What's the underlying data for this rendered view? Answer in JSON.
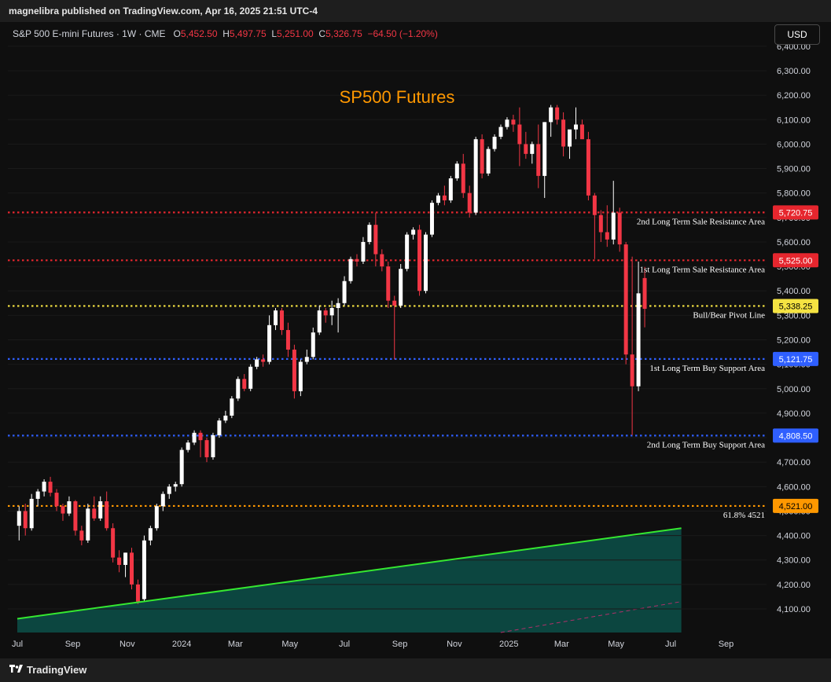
{
  "publisher": {
    "text": "magnelibra published on TradingView.com, Apr 16, 2025 21:51 UTC-4"
  },
  "legend": {
    "symbol": "S&P 500 E-mini Futures · 1W · CME",
    "open_label": "O",
    "open": "5,452.50",
    "high_label": "H",
    "high": "5,497.75",
    "low_label": "L",
    "low": "5,251.00",
    "close_label": "C",
    "close": "5,326.75",
    "change": "−64.50 (−1.20%)"
  },
  "currency": "USD",
  "footer": {
    "brand": "TradingView"
  },
  "colors": {
    "background": "#0f0f0f",
    "up": "#ffffff",
    "down": "#f23645",
    "title": "#ff9800",
    "trendline": "#35e830",
    "fill": "#0d4a43",
    "resistance": "#e6262e",
    "pivot": "#f5e342",
    "support": "#2f5fff",
    "fib": "#ff9800"
  },
  "chart_data": {
    "type": "candlestick",
    "title": "SP500 Futures",
    "x_ticks": [
      "Jul",
      "Sep",
      "Nov",
      "2024",
      "Mar",
      "May",
      "Jul",
      "Sep",
      "Nov",
      "2025",
      "Mar",
      "May",
      "Jul",
      "Sep"
    ],
    "y_ticks": [
      "4,100.00",
      "4,200.00",
      "4,300.00",
      "4,400.00",
      "4,500.00",
      "4,600.00",
      "4,700.00",
      "4,800.00",
      "4,900.00",
      "5,000.00",
      "5,100.00",
      "5,200.00",
      "5,300.00",
      "5,400.00",
      "5,500.00",
      "5,600.00",
      "5,700.00",
      "5,800.00",
      "5,900.00",
      "6,000.00",
      "6,100.00",
      "6,200.00",
      "6,300.00",
      "6,400.00"
    ],
    "ylim": [
      4060,
      6420
    ],
    "x_range": [
      "2023-07-01",
      "2025-10-01"
    ],
    "levels": [
      {
        "value": 5720.75,
        "label": "5,720.75",
        "name": "2nd Long Term Sale Resistance Area",
        "color": "#e6262e",
        "text_color": "#ffffff"
      },
      {
        "value": 5525.0,
        "label": "5,525.00",
        "name": "1st Long Term Sale Resistance Area",
        "color": "#e6262e",
        "text_color": "#ffffff"
      },
      {
        "value": 5338.25,
        "label": "5,338.25",
        "name": "Bull/Bear Pivot Line",
        "color": "#f5e342",
        "text_color": "#000000"
      },
      {
        "value": 5121.75,
        "label": "5,121.75",
        "name": "1st Long Term Buy Support Area",
        "color": "#2f5fff",
        "text_color": "#ffffff"
      },
      {
        "value": 4808.5,
        "label": "4,808.50",
        "name": "2nd Long Term Buy Support Area",
        "color": "#2f5fff",
        "text_color": "#ffffff"
      },
      {
        "value": 4521.0,
        "label": "4,521.00",
        "name": "61.8% 4521",
        "color": "#ff9800",
        "text_color": "#000000"
      }
    ],
    "trendline": {
      "start": {
        "date": "2023-07-01",
        "value": 4060
      },
      "end": {
        "date": "2025-07-13",
        "value": 4430
      }
    },
    "candles": [
      {
        "date": "2023-07-03",
        "open": 4440,
        "high": 4520,
        "low": 4380,
        "close": 4500
      },
      {
        "date": "2023-07-10",
        "open": 4500,
        "high": 4530,
        "low": 4400,
        "close": 4430
      },
      {
        "date": "2023-07-17",
        "open": 4430,
        "high": 4570,
        "low": 4420,
        "close": 4550
      },
      {
        "date": "2023-07-24",
        "open": 4550,
        "high": 4590,
        "low": 4520,
        "close": 4580
      },
      {
        "date": "2023-07-31",
        "open": 4580,
        "high": 4630,
        "low": 4560,
        "close": 4620
      },
      {
        "date": "2023-08-07",
        "open": 4620,
        "high": 4640,
        "low": 4560,
        "close": 4575
      },
      {
        "date": "2023-08-14",
        "open": 4575,
        "high": 4590,
        "low": 4500,
        "close": 4520
      },
      {
        "date": "2023-08-21",
        "open": 4520,
        "high": 4530,
        "low": 4460,
        "close": 4490
      },
      {
        "date": "2023-08-28",
        "open": 4490,
        "high": 4560,
        "low": 4480,
        "close": 4540
      },
      {
        "date": "2023-09-04",
        "open": 4540,
        "high": 4545,
        "low": 4400,
        "close": 4420
      },
      {
        "date": "2023-09-11",
        "open": 4420,
        "high": 4440,
        "low": 4360,
        "close": 4380
      },
      {
        "date": "2023-09-18",
        "open": 4380,
        "high": 4530,
        "low": 4370,
        "close": 4510
      },
      {
        "date": "2023-09-25",
        "open": 4510,
        "high": 4560,
        "low": 4460,
        "close": 4470
      },
      {
        "date": "2023-10-02",
        "open": 4470,
        "high": 4560,
        "low": 4460,
        "close": 4540
      },
      {
        "date": "2023-10-09",
        "open": 4540,
        "high": 4580,
        "low": 4420,
        "close": 4430
      },
      {
        "date": "2023-10-16",
        "open": 4430,
        "high": 4450,
        "low": 4290,
        "close": 4310
      },
      {
        "date": "2023-10-23",
        "open": 4310,
        "high": 4340,
        "low": 4250,
        "close": 4280
      },
      {
        "date": "2023-10-30",
        "open": 4280,
        "high": 4330,
        "low": 4230,
        "close": 4330
      },
      {
        "date": "2023-11-06",
        "open": 4330,
        "high": 4350,
        "low": 4180,
        "close": 4200
      },
      {
        "date": "2023-11-13",
        "open": 4200,
        "high": 4220,
        "low": 4120,
        "close": 4130
      },
      {
        "date": "2023-11-20",
        "open": 4140,
        "high": 4400,
        "low": 4130,
        "close": 4380
      },
      {
        "date": "2023-11-27",
        "open": 4380,
        "high": 4440,
        "low": 4360,
        "close": 4430
      },
      {
        "date": "2023-12-04",
        "open": 4430,
        "high": 4530,
        "low": 4420,
        "close": 4520
      },
      {
        "date": "2023-12-11",
        "open": 4520,
        "high": 4580,
        "low": 4500,
        "close": 4570
      },
      {
        "date": "2023-12-18",
        "open": 4570,
        "high": 4610,
        "low": 4550,
        "close": 4600
      },
      {
        "date": "2023-12-25",
        "open": 4600,
        "high": 4620,
        "low": 4580,
        "close": 4610
      },
      {
        "date": "2024-01-01",
        "open": 4610,
        "high": 4760,
        "low": 4600,
        "close": 4750
      },
      {
        "date": "2024-01-08",
        "open": 4750,
        "high": 4790,
        "low": 4740,
        "close": 4780
      },
      {
        "date": "2024-01-15",
        "open": 4780,
        "high": 4830,
        "low": 4770,
        "close": 4820
      },
      {
        "date": "2024-01-22",
        "open": 4820,
        "high": 4830,
        "low": 4720,
        "close": 4790
      },
      {
        "date": "2024-01-29",
        "open": 4790,
        "high": 4800,
        "low": 4700,
        "close": 4720
      },
      {
        "date": "2024-02-05",
        "open": 4720,
        "high": 4820,
        "low": 4710,
        "close": 4810
      },
      {
        "date": "2024-02-12",
        "open": 4810,
        "high": 4880,
        "low": 4800,
        "close": 4870
      },
      {
        "date": "2024-02-19",
        "open": 4870,
        "high": 4910,
        "low": 4860,
        "close": 4890
      },
      {
        "date": "2024-02-26",
        "open": 4890,
        "high": 4970,
        "low": 4880,
        "close": 4960
      },
      {
        "date": "2024-03-04",
        "open": 4960,
        "high": 5050,
        "low": 4950,
        "close": 5040
      },
      {
        "date": "2024-03-11",
        "open": 5040,
        "high": 5060,
        "low": 4990,
        "close": 5000
      },
      {
        "date": "2024-03-18",
        "open": 5000,
        "high": 5100,
        "low": 4990,
        "close": 5090
      },
      {
        "date": "2024-03-25",
        "open": 5090,
        "high": 5130,
        "low": 5080,
        "close": 5120
      },
      {
        "date": "2024-04-01",
        "open": 5120,
        "high": 5140,
        "low": 5090,
        "close": 5110
      },
      {
        "date": "2024-04-08",
        "open": 5110,
        "high": 5300,
        "low": 5100,
        "close": 5260
      },
      {
        "date": "2024-04-15",
        "open": 5260,
        "high": 5330,
        "low": 5240,
        "close": 5320
      },
      {
        "date": "2024-04-22",
        "open": 5320,
        "high": 5330,
        "low": 5220,
        "close": 5240
      },
      {
        "date": "2024-04-29",
        "open": 5240,
        "high": 5270,
        "low": 5130,
        "close": 5160
      },
      {
        "date": "2024-05-06",
        "open": 5160,
        "high": 5180,
        "low": 4960,
        "close": 4990
      },
      {
        "date": "2024-05-13",
        "open": 4990,
        "high": 5120,
        "low": 4970,
        "close": 5110
      },
      {
        "date": "2024-05-20",
        "open": 5110,
        "high": 5160,
        "low": 5100,
        "close": 5130
      },
      {
        "date": "2024-05-27",
        "open": 5130,
        "high": 5250,
        "low": 5120,
        "close": 5230
      },
      {
        "date": "2024-06-03",
        "open": 5230,
        "high": 5340,
        "low": 5220,
        "close": 5320
      },
      {
        "date": "2024-06-10",
        "open": 5320,
        "high": 5330,
        "low": 5270,
        "close": 5300
      },
      {
        "date": "2024-06-17",
        "open": 5300,
        "high": 5360,
        "low": 5260,
        "close": 5330
      },
      {
        "date": "2024-06-24",
        "open": 5330,
        "high": 5370,
        "low": 5230,
        "close": 5350
      },
      {
        "date": "2024-07-01",
        "open": 5350,
        "high": 5460,
        "low": 5340,
        "close": 5440
      },
      {
        "date": "2024-07-08",
        "open": 5440,
        "high": 5540,
        "low": 5430,
        "close": 5530
      },
      {
        "date": "2024-07-15",
        "open": 5530,
        "high": 5550,
        "low": 5500,
        "close": 5520
      },
      {
        "date": "2024-07-22",
        "open": 5520,
        "high": 5620,
        "low": 5510,
        "close": 5600
      },
      {
        "date": "2024-07-29",
        "open": 5600,
        "high": 5680,
        "low": 5590,
        "close": 5670
      },
      {
        "date": "2024-08-05",
        "open": 5670,
        "high": 5720,
        "low": 5500,
        "close": 5550
      },
      {
        "date": "2024-08-12",
        "open": 5550,
        "high": 5570,
        "low": 5480,
        "close": 5500
      },
      {
        "date": "2024-08-19",
        "open": 5500,
        "high": 5520,
        "low": 5330,
        "close": 5360
      },
      {
        "date": "2024-08-26",
        "open": 5360,
        "high": 5380,
        "low": 5120,
        "close": 5340
      },
      {
        "date": "2024-09-02",
        "open": 5340,
        "high": 5510,
        "low": 5330,
        "close": 5490
      },
      {
        "date": "2024-09-09",
        "open": 5490,
        "high": 5640,
        "low": 5480,
        "close": 5630
      },
      {
        "date": "2024-09-16",
        "open": 5630,
        "high": 5660,
        "low": 5610,
        "close": 5650
      },
      {
        "date": "2024-09-23",
        "open": 5650,
        "high": 5670,
        "low": 5380,
        "close": 5400
      },
      {
        "date": "2024-09-30",
        "open": 5400,
        "high": 5640,
        "low": 5390,
        "close": 5630
      },
      {
        "date": "2024-10-07",
        "open": 5630,
        "high": 5770,
        "low": 5620,
        "close": 5760
      },
      {
        "date": "2024-10-14",
        "open": 5760,
        "high": 5800,
        "low": 5750,
        "close": 5790
      },
      {
        "date": "2024-10-21",
        "open": 5790,
        "high": 5830,
        "low": 5750,
        "close": 5770
      },
      {
        "date": "2024-10-28",
        "open": 5770,
        "high": 5870,
        "low": 5760,
        "close": 5860
      },
      {
        "date": "2024-11-04",
        "open": 5860,
        "high": 5930,
        "low": 5850,
        "close": 5920
      },
      {
        "date": "2024-11-11",
        "open": 5920,
        "high": 5960,
        "low": 5780,
        "close": 5800
      },
      {
        "date": "2024-11-18",
        "open": 5800,
        "high": 5830,
        "low": 5700,
        "close": 5720
      },
      {
        "date": "2024-11-25",
        "open": 5720,
        "high": 6030,
        "low": 5710,
        "close": 6020
      },
      {
        "date": "2024-12-02",
        "open": 6020,
        "high": 6040,
        "low": 5860,
        "close": 5880
      },
      {
        "date": "2024-12-09",
        "open": 5880,
        "high": 5990,
        "low": 5870,
        "close": 5980
      },
      {
        "date": "2024-12-16",
        "open": 5980,
        "high": 6040,
        "low": 5970,
        "close": 6030
      },
      {
        "date": "2024-12-23",
        "open": 6030,
        "high": 6080,
        "low": 6020,
        "close": 6070
      },
      {
        "date": "2024-12-30",
        "open": 6070,
        "high": 6110,
        "low": 6060,
        "close": 6100
      },
      {
        "date": "2025-01-06",
        "open": 6100,
        "high": 6120,
        "low": 6050,
        "close": 6080
      },
      {
        "date": "2025-01-13",
        "open": 6080,
        "high": 6150,
        "low": 5910,
        "close": 6000
      },
      {
        "date": "2025-01-20",
        "open": 6000,
        "high": 6050,
        "low": 5940,
        "close": 5960
      },
      {
        "date": "2025-01-27",
        "open": 5960,
        "high": 6010,
        "low": 5920,
        "close": 6000
      },
      {
        "date": "2025-02-03",
        "open": 6000,
        "high": 6080,
        "low": 5820,
        "close": 5870
      },
      {
        "date": "2025-02-10",
        "open": 5870,
        "high": 6090,
        "low": 5780,
        "close": 6090
      },
      {
        "date": "2025-02-17",
        "open": 6090,
        "high": 6160,
        "low": 6030,
        "close": 6150
      },
      {
        "date": "2025-02-24",
        "open": 6150,
        "high": 6160,
        "low": 6080,
        "close": 6100
      },
      {
        "date": "2025-03-03",
        "open": 6100,
        "high": 6130,
        "low": 5950,
        "close": 5990
      },
      {
        "date": "2025-03-10",
        "open": 5990,
        "high": 6020,
        "low": 5940,
        "close": 6060
      },
      {
        "date": "2025-03-17",
        "open": 6060,
        "high": 6150,
        "low": 6020,
        "close": 6080
      },
      {
        "date": "2025-03-24",
        "open": 6080,
        "high": 6100,
        "low": 6040,
        "close": 6020
      },
      {
        "date": "2025-03-31",
        "open": 6020,
        "high": 6050,
        "low": 5770,
        "close": 5790
      },
      {
        "date": "2025-04-07",
        "open": 5790,
        "high": 5800,
        "low": 5530,
        "close": 5710
      },
      {
        "date": "2025-04-14",
        "open": 5710,
        "high": 5730,
        "low": 5600,
        "close": 5640
      },
      {
        "date": "2025-04-21",
        "open": 5640,
        "high": 5750,
        "low": 5580,
        "close": 5610
      },
      {
        "date": "2025-04-28",
        "open": 5610,
        "high": 5850,
        "low": 5590,
        "close": 5720
      },
      {
        "date": "2025-05-05",
        "open": 5720,
        "high": 5740,
        "low": 5560,
        "close": 5590
      },
      {
        "date": "2025-05-12",
        "open": 5590,
        "high": 5600,
        "low": 5100,
        "close": 5140
      },
      {
        "date": "2025-05-19",
        "open": 5140,
        "high": 5540,
        "low": 4810,
        "close": 5010
      },
      {
        "date": "2025-05-26",
        "open": 5010,
        "high": 5520,
        "low": 4990,
        "close": 5390
      },
      {
        "date": "2025-06-02",
        "open": 5452.5,
        "high": 5497.75,
        "low": 5251,
        "close": 5326.75
      }
    ]
  }
}
